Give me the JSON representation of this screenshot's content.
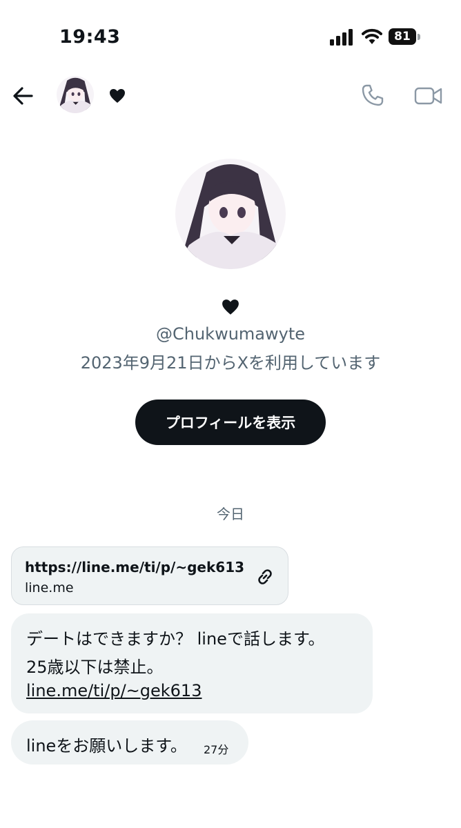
{
  "status_bar": {
    "time": "19:43",
    "battery": "81"
  },
  "header": {
    "back_icon": "arrow-left-icon",
    "heart_icon": "heart-icon",
    "call_icon": "phone-icon",
    "video_icon": "video-camera-icon"
  },
  "profile": {
    "handle": "@Chukwumawyte",
    "joined": "2023年9月21日からXを利用しています",
    "view_profile_label": "プロフィールを表示"
  },
  "conversation": {
    "date_separator": "今日",
    "link_card": {
      "url": "https://line.me/ti/p/~gek613",
      "domain": "line.me",
      "icon": "link-icon"
    },
    "message1": {
      "line1": "デートはできますか？ lineで話します。",
      "line2": "25歳以下は禁止。",
      "link": "line.me/ti/p/~gek613"
    },
    "message2": {
      "text": "lineをお願いします。",
      "time": "27分"
    }
  },
  "colors": {
    "text": "#0f1419",
    "secondary": "#536471",
    "bubble": "#eff3f4",
    "button": "#0f1419"
  }
}
